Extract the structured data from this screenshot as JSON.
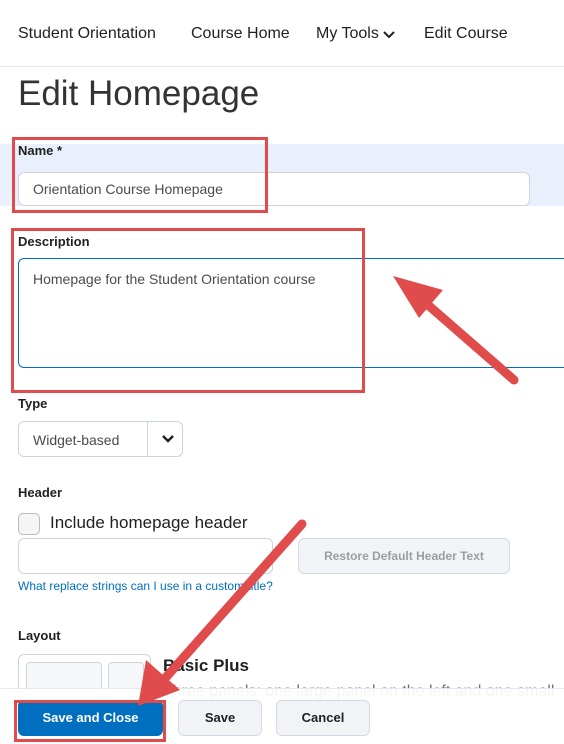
{
  "nav": {
    "items": [
      {
        "label": "Student Orientation"
      },
      {
        "label": "Course Home"
      },
      {
        "label": "My Tools"
      },
      {
        "label": "Edit Course"
      }
    ]
  },
  "page_title": "Edit Homepage",
  "form": {
    "name": {
      "label": "Name *",
      "value": "Orientation Course Homepage"
    },
    "description": {
      "label": "Description",
      "value": "Homepage for the Student Orientation course"
    },
    "type": {
      "label": "Type",
      "selected": "Widget-based"
    },
    "header": {
      "label": "Header",
      "checkbox_label": "Include homepage header",
      "restore_button": "Restore Default Header Text",
      "help_link": "What replace strings can I use in a custom title?"
    },
    "layout": {
      "label": "Layout",
      "name": "Basic Plus",
      "description": "Three panels: one large panel on the left and one small"
    }
  },
  "footer": {
    "save_close": "Save and Close",
    "save": "Save",
    "cancel": "Cancel"
  },
  "colors": {
    "primary": "#006fbf",
    "annotation": "#e04b4b"
  }
}
